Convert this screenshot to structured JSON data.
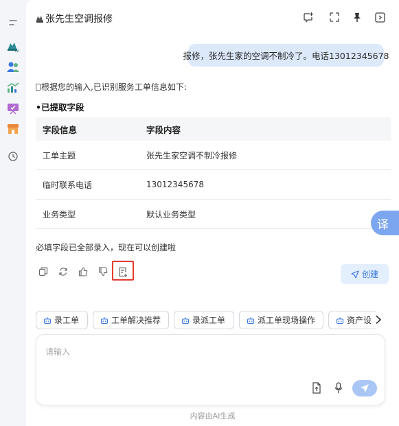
{
  "header": {
    "title": "张先生空调报修"
  },
  "conversation": {
    "user_message": "报修，张先生家的空调不制冷了。电话13012345678",
    "intro": "根据您的输入,已识别服务工单信息如下:",
    "subheading": "•已提取字段",
    "table": {
      "headers": [
        "字段信息",
        "字段内容"
      ],
      "rows": [
        [
          "工单主题",
          "张先生家空调不制冷报修"
        ],
        [
          "临时联系电话",
          "13012345678"
        ],
        [
          "业务类型",
          "默认业务类型"
        ]
      ]
    },
    "completion_note": "必填字段已全部录入，现在可以创建啦",
    "create_label": "创建"
  },
  "translate_label": "译",
  "quick_actions": [
    "录工单",
    "工单解决推荐",
    "录派工单",
    "派工单现场操作",
    "资产设"
  ],
  "input": {
    "placeholder": "请输入"
  },
  "footer": "内容由AI生成",
  "colors": {
    "accent": "#3a78e0",
    "user_bubble": "#dce9fb",
    "highlight_box": "#e23b2e",
    "send_button": "#a9c6f5"
  }
}
